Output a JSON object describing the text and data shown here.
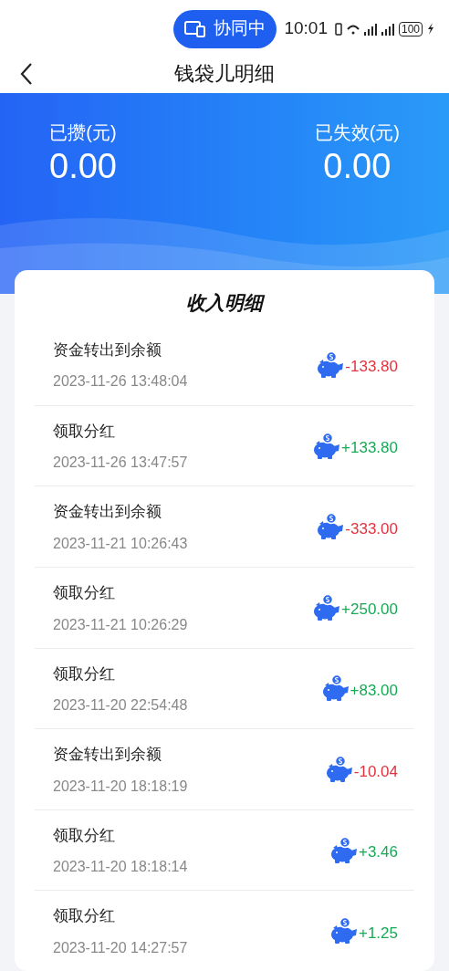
{
  "status_bar": {
    "collab_label": "协同中",
    "time": "10:01",
    "battery": "100"
  },
  "header": {
    "title": "钱袋儿明细"
  },
  "summary": [
    {
      "label": "已攒(元)",
      "value": "0.00"
    },
    {
      "label": "已失效(元)",
      "value": "0.00"
    }
  ],
  "card": {
    "title": "收入明细",
    "rows": [
      {
        "title": "资金转出到余额",
        "time": "2023-11-26 13:48:04",
        "amount": "-133.80",
        "kind": "debit"
      },
      {
        "title": "领取分红",
        "time": "2023-11-26 13:47:57",
        "amount": "+133.80",
        "kind": "credit"
      },
      {
        "title": "资金转出到余额",
        "time": "2023-11-21 10:26:43",
        "amount": "-333.00",
        "kind": "debit"
      },
      {
        "title": "领取分红",
        "time": "2023-11-21 10:26:29",
        "amount": "+250.00",
        "kind": "credit"
      },
      {
        "title": "领取分红",
        "time": "2023-11-20 22:54:48",
        "amount": "+83.00",
        "kind": "credit"
      },
      {
        "title": "资金转出到余额",
        "time": "2023-11-20 18:18:19",
        "amount": "-10.04",
        "kind": "debit"
      },
      {
        "title": "领取分红",
        "time": "2023-11-20 18:18:14",
        "amount": "+3.46",
        "kind": "credit"
      },
      {
        "title": "领取分红",
        "time": "2023-11-20 14:27:57",
        "amount": "+1.25",
        "kind": "credit"
      }
    ]
  }
}
